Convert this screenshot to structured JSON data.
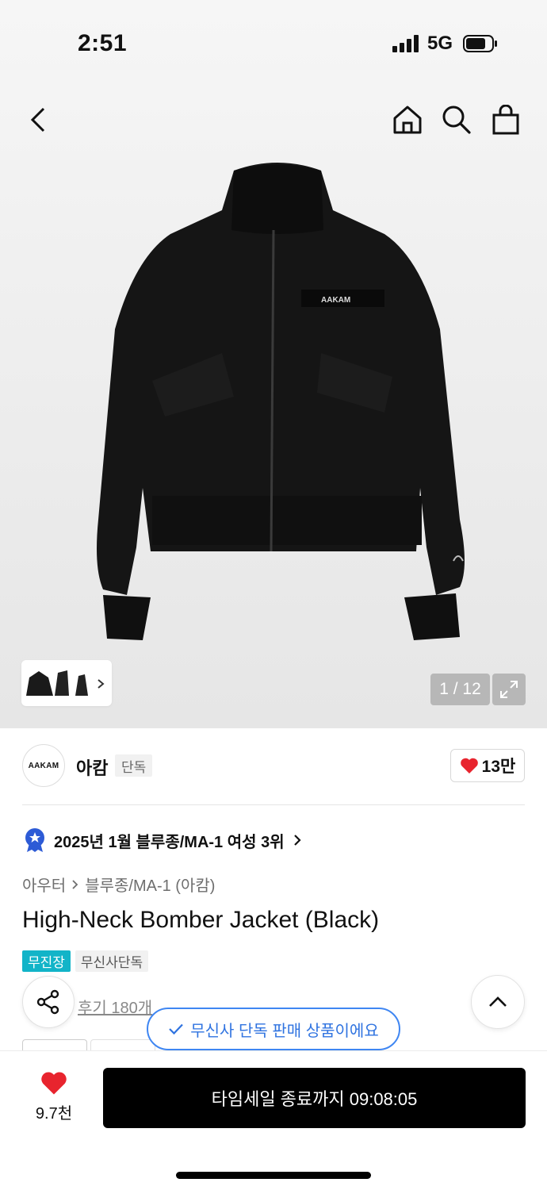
{
  "status_bar": {
    "time": "2:51",
    "network": "5G"
  },
  "nav": {
    "back_icon": "chevron-left-icon",
    "home_icon": "home-icon",
    "search_icon": "search-icon",
    "cart_icon": "shopping-bag-icon"
  },
  "gallery": {
    "jacket_label": "AAKAM",
    "counter": "1 / 12",
    "expand_icon": "expand-icon"
  },
  "brand": {
    "logo_text": "AAKAM",
    "name": "아캄",
    "exclusive_tag": "단독",
    "likes": "13만"
  },
  "ranking": {
    "text": "2025년 1월 블루종/MA-1 여성 3위"
  },
  "breadcrumb": {
    "category": "아우터",
    "subcategory": "블루종/MA-1 (아캄)"
  },
  "product": {
    "title": "High-Neck Bomber Jacket (Black)",
    "tags": [
      "무진장",
      "무신사단독"
    ],
    "reviews": "후기 180개"
  },
  "toast": {
    "text": "무신사 단독 판매 상품이에요"
  },
  "bottom_bar": {
    "wish_count": "9.7천",
    "buy_label": "타임세일 종료까지 09:08:05"
  },
  "colors": {
    "accent_cyan": "#12b4c8",
    "toast_blue": "#2f73e0",
    "heart_red": "#e8242e",
    "button_black": "#000000"
  }
}
